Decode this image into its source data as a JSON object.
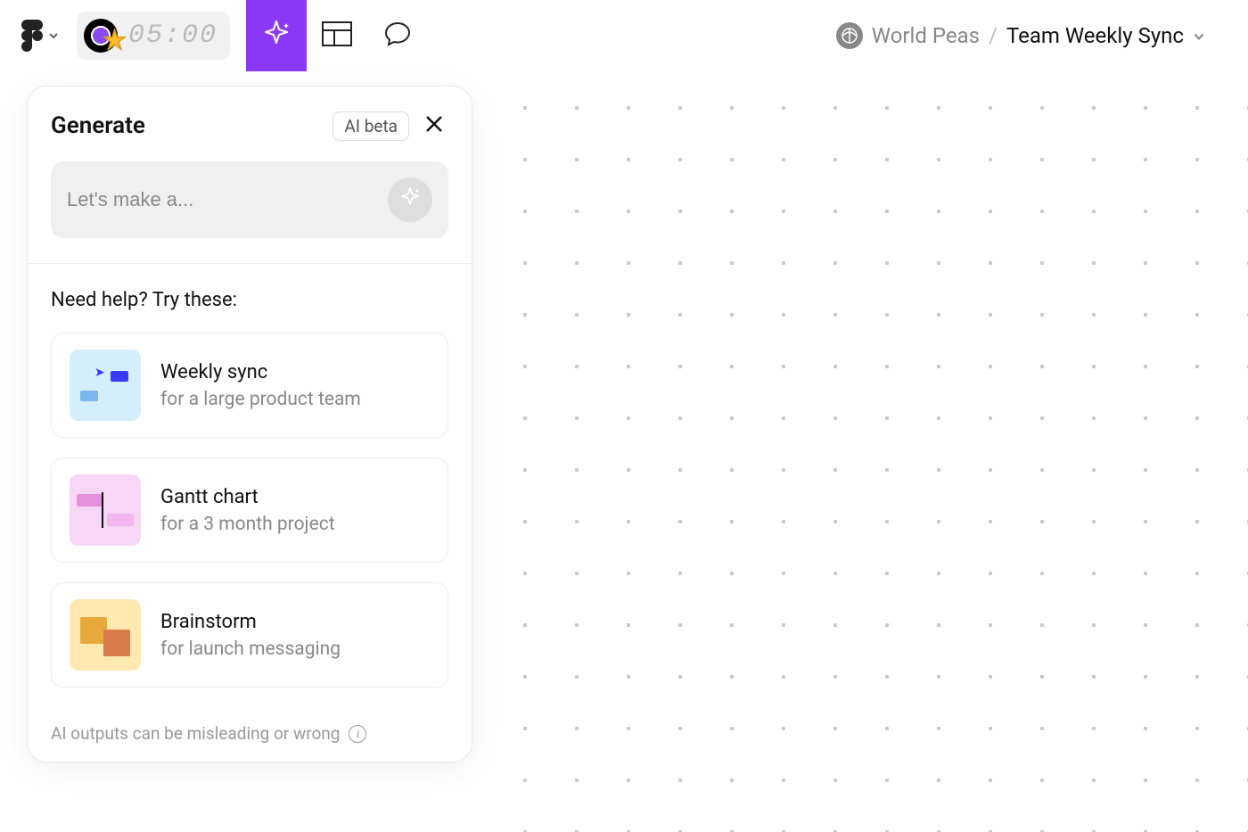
{
  "toolbar": {
    "timer": "05:00"
  },
  "breadcrumb": {
    "project": "World Peas",
    "separator": "/",
    "file": "Team Weekly Sync"
  },
  "panel": {
    "title": "Generate",
    "badge": "AI beta",
    "prompt_placeholder": "Let's make a...",
    "suggestions_heading": "Need help? Try these:",
    "suggestions": [
      {
        "title": "Weekly sync",
        "subtitle": "for a large product team"
      },
      {
        "title": "Gantt chart",
        "subtitle": "for a 3 month project"
      },
      {
        "title": "Brainstorm",
        "subtitle": "for launch messaging"
      }
    ],
    "footer_text": "AI outputs can be misleading or wrong"
  }
}
